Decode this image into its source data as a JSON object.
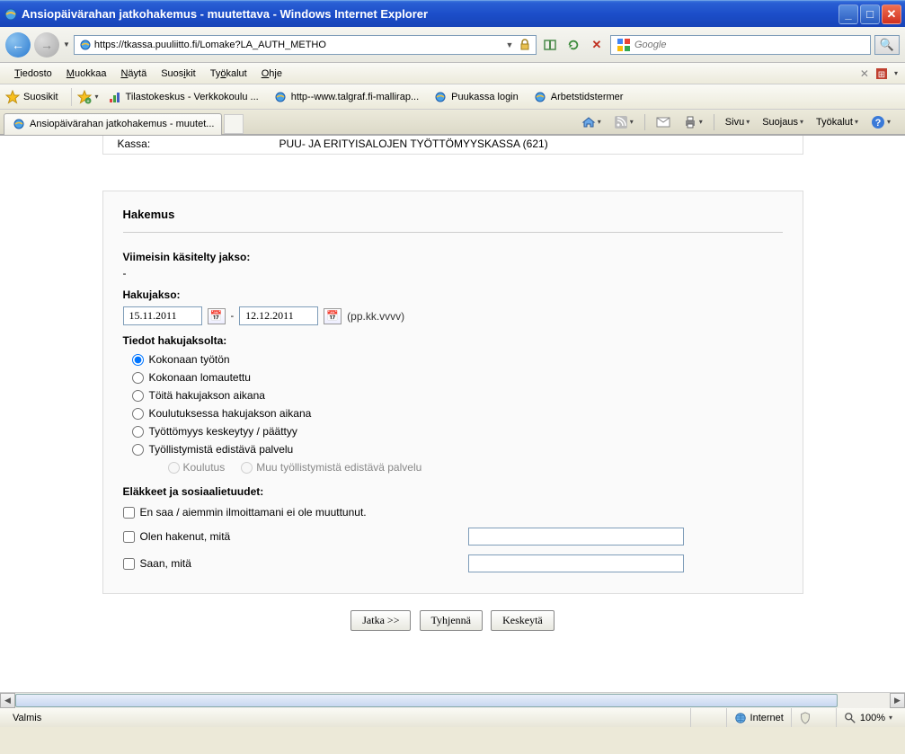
{
  "window": {
    "title": "Ansiopäivärahan jatkohakemus - muutettava - Windows Internet Explorer"
  },
  "addressbar": {
    "url": "https://tkassa.puuliitto.fi/Lomake?LA_AUTH_METHO"
  },
  "search": {
    "placeholder": "Google"
  },
  "menu": {
    "file": "Tiedosto",
    "edit": "Muokkaa",
    "view": "Näytä",
    "favorites": "Suosikit",
    "tools": "Työkalut",
    "help": "Ohje"
  },
  "favbar": {
    "label": "Suosikit",
    "links": [
      "Tilastokeskus - Verkkokoulu ...",
      "http--www.talgraf.fi-mallirap...",
      "Puukassa login",
      "Arbetstidstermer"
    ]
  },
  "tabs": {
    "active": "Ansiopäivärahan jatkohakemus - muutet..."
  },
  "commandbar": {
    "page": "Sivu",
    "safety": "Suojaus",
    "tools": "Työkalut"
  },
  "page": {
    "kassa_label": "Kassa:",
    "kassa_value": "PUU- JA ERITYISALOJEN TYÖTTÖMYYSKASSA (621)",
    "panel_title": "Hakemus",
    "viimeisin_head": "Viimeisin käsitelty jakso:",
    "viimeisin_value": "-",
    "hakujakso_head": "Hakujakso:",
    "date_from": "15.11.2011",
    "date_to": "12.12.2011",
    "date_hint": "(pp.kk.vvvv)",
    "tiedot_head": "Tiedot hakujaksolta:",
    "radios": [
      "Kokonaan työtön",
      "Kokonaan lomautettu",
      "Töitä hakujakson aikana",
      "Koulutuksessa hakujakson aikana",
      "Työttömyys keskeytyy / päättyy",
      "Työllistymistä edistävä palvelu"
    ],
    "sub_radios": [
      "Koulutus",
      "Muu työllistymistä edistävä palvelu"
    ],
    "elakkeet_head": "Eläkkeet ja sosiaalietuudet:",
    "checks": [
      "En saa / aiemmin ilmoittamani ei ole muuttunut.",
      "Olen hakenut, mitä",
      "Saan, mitä"
    ],
    "buttons": {
      "continue": "Jatka >>",
      "clear": "Tyhjennä",
      "cancel": "Keskeytä"
    }
  },
  "statusbar": {
    "status": "Valmis",
    "zone": "Internet",
    "zoom": "100%"
  }
}
